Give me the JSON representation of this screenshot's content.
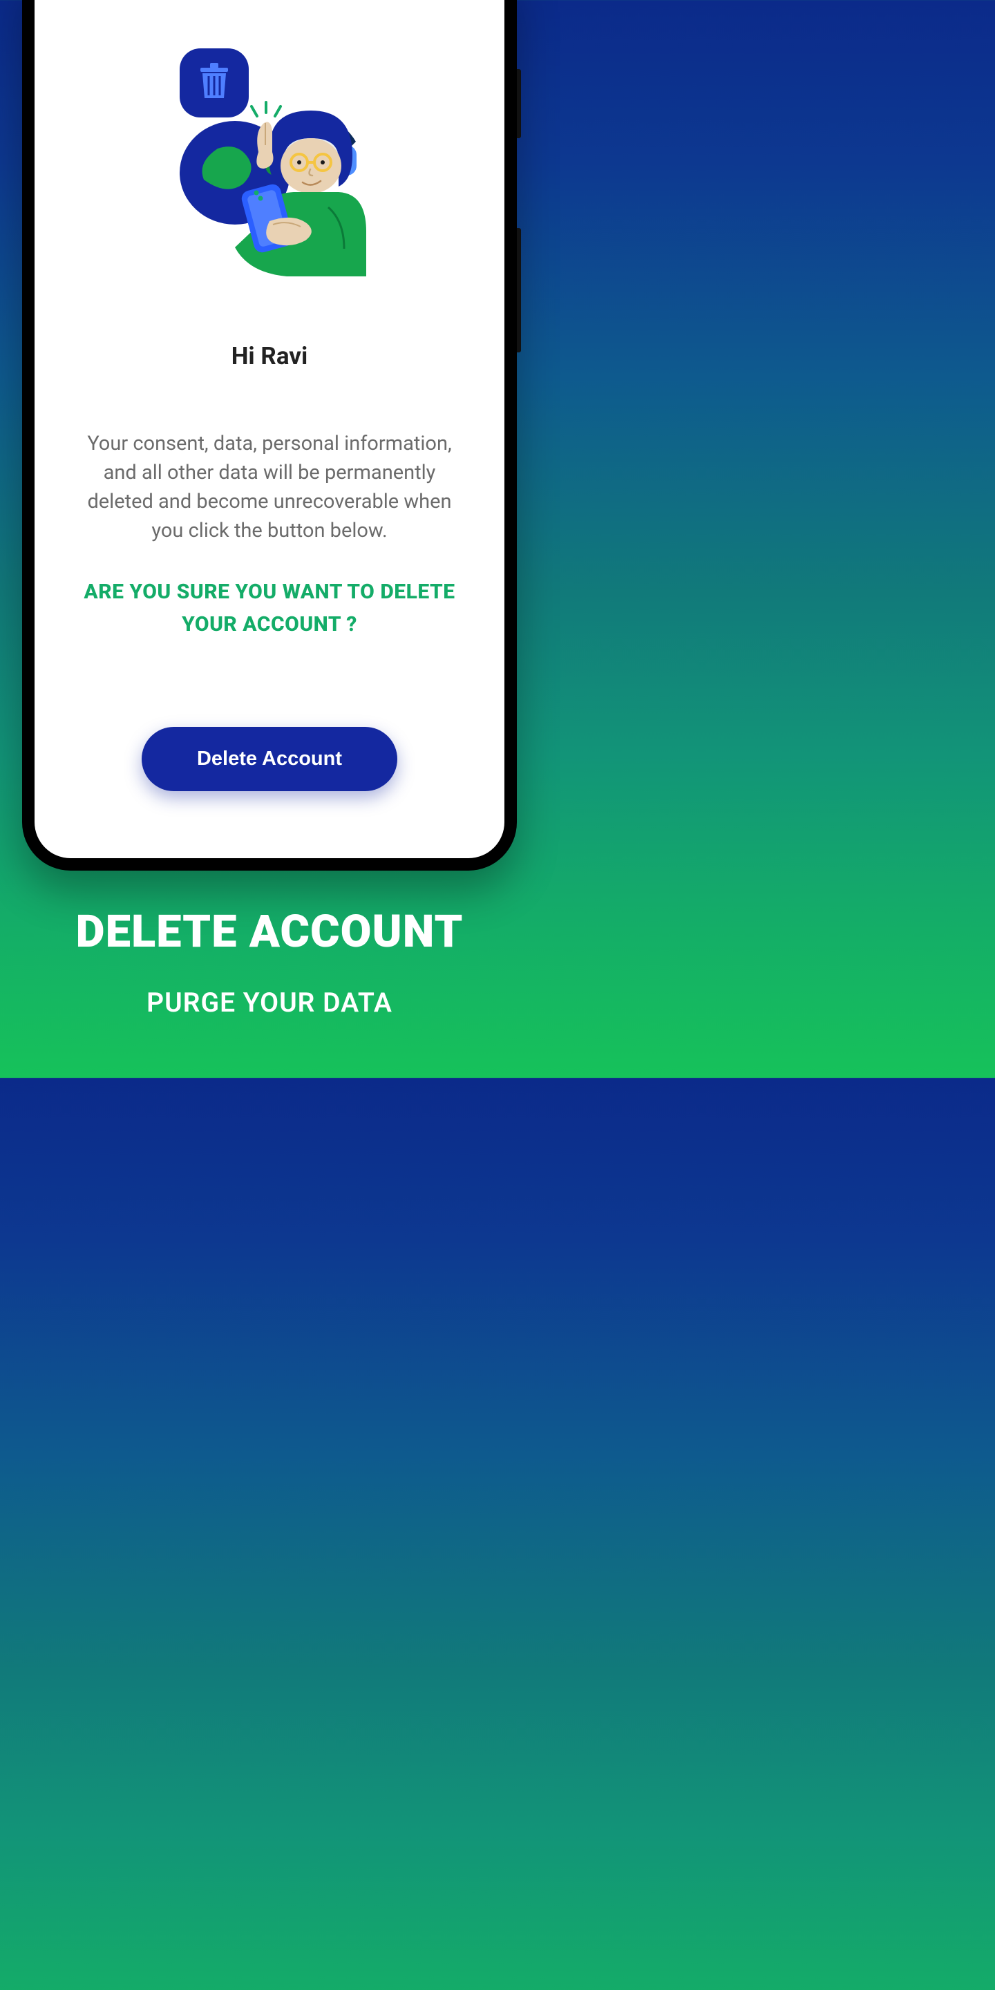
{
  "screen": {
    "greeting": "Hi Ravi",
    "body": "Your consent, data, personal information, and all other data will be permanently deleted and become unrecoverable when you click the button below.",
    "confirm": "ARE YOU SURE YOU WANT TO DELETE YOUR ACCOUNT ?",
    "button_label": "Delete Account"
  },
  "footer": {
    "title": "DELETE ACCOUNT",
    "subtitle": "PURGE YOUR DATA"
  },
  "colors": {
    "primary_blue": "#1428a0",
    "accent_green": "#14ac68",
    "dark_navy": "#0b2b59"
  }
}
